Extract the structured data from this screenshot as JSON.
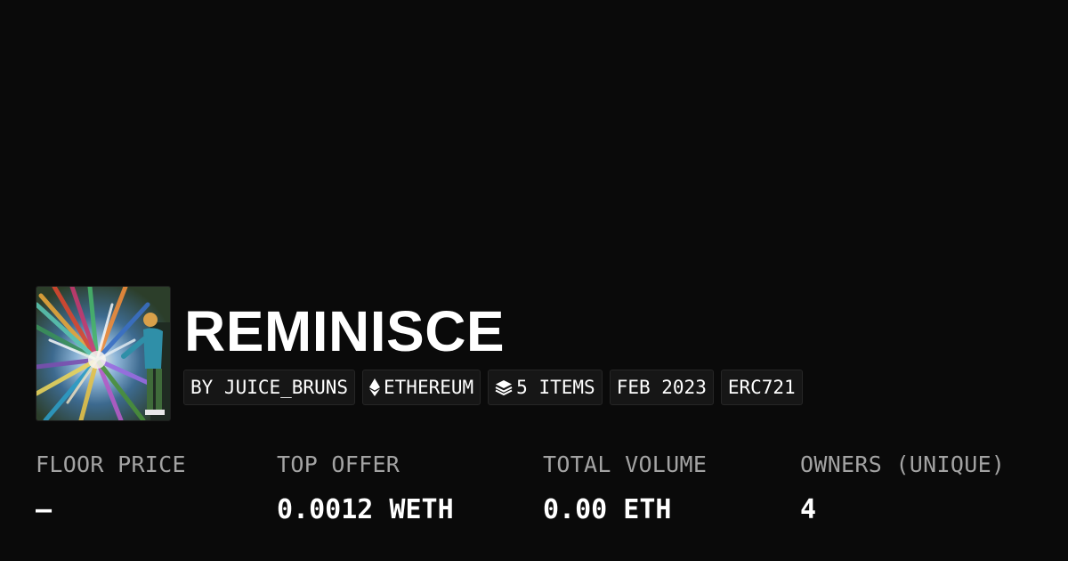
{
  "collection": {
    "title": "REMINISCE",
    "thumbnail_alt": "collection artwork"
  },
  "tags": [
    {
      "label": "BY JUICE_BRUNS",
      "icon": null
    },
    {
      "label": "ETHEREUM",
      "icon": "ethereum-icon"
    },
    {
      "label": "5 ITEMS",
      "icon": "layers-icon"
    },
    {
      "label": "FEB 2023",
      "icon": null
    },
    {
      "label": "ERC721",
      "icon": null
    }
  ],
  "stats": {
    "floor_price": {
      "label": "FLOOR PRICE",
      "value": "–"
    },
    "top_offer": {
      "label": "TOP OFFER",
      "value": "0.0012 WETH"
    },
    "total_volume": {
      "label": "TOTAL VOLUME",
      "value": "0.00 ETH"
    },
    "owners": {
      "label": "OWNERS (UNIQUE)",
      "value": "4"
    }
  },
  "colors": {
    "background": "#0a0a0a",
    "tag_background": "#161616",
    "label_gray": "#a3a3a3",
    "text": "#ffffff"
  }
}
